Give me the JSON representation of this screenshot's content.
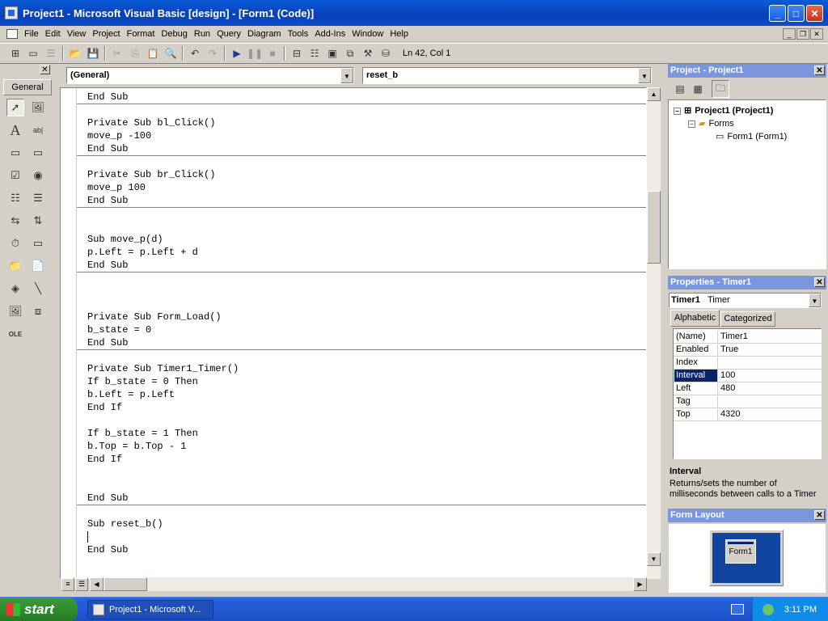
{
  "window": {
    "title": "Project1 - Microsoft Visual Basic [design] - [Form1 (Code)]",
    "minimize": "_",
    "maximize": "□",
    "close": "✕"
  },
  "menu": {
    "items": [
      "File",
      "Edit",
      "View",
      "Project",
      "Format",
      "Debug",
      "Run",
      "Query",
      "Diagram",
      "Tools",
      "Add-Ins",
      "Window",
      "Help"
    ]
  },
  "toolbar": {
    "status": "Ln 42, Col 1",
    "icons": [
      "add-project-icon",
      "add-form-icon",
      "menu-editor-icon",
      "open-icon",
      "save-icon",
      "cut-icon",
      "copy-icon",
      "paste-icon",
      "find-icon",
      "undo-icon",
      "redo-icon",
      "start-icon",
      "break-icon",
      "end-icon",
      "project-explorer-icon",
      "properties-window-icon",
      "form-layout-icon",
      "object-browser-icon",
      "toolbox-icon",
      "data-view-icon"
    ]
  },
  "toolbox": {
    "close": "✕",
    "tab": "General"
  },
  "code": {
    "object_combo": "(General)",
    "proc_combo": "reset_b",
    "lines": [
      "End Sub",
      "Private Sub bl_Click()",
      "move_p -100",
      "End Sub",
      "Private Sub br_Click()",
      "move_p 100",
      "End Sub",
      "Sub move_p(d)",
      "p.Left = p.Left + d",
      "End Sub",
      "Private Sub Form_Load()",
      "b_state = 0",
      "End Sub",
      "Private Sub Timer1_Timer()",
      "If b_state = 0 Then",
      "b.Left = p.Left",
      "End If",
      "If b_state = 1 Then",
      "b.Top = b.Top - 1",
      "End If",
      "End Sub",
      "Sub reset_b()",
      "End Sub"
    ]
  },
  "project": {
    "title": "Project - Project1",
    "close": "✕",
    "root": "Project1 (Project1)",
    "folder": "Forms",
    "form": "Form1 (Form1)"
  },
  "properties": {
    "title": "Properties - Timer1",
    "close": "✕",
    "object": "Timer1",
    "object_type": "Timer",
    "tabs": [
      "Alphabetic",
      "Categorized"
    ],
    "rows": [
      {
        "k": "(Name)",
        "v": "Timer1"
      },
      {
        "k": "Enabled",
        "v": "True"
      },
      {
        "k": "Index",
        "v": ""
      },
      {
        "k": "Interval",
        "v": "100"
      },
      {
        "k": "Left",
        "v": "480"
      },
      {
        "k": "Tag",
        "v": ""
      },
      {
        "k": "Top",
        "v": "4320"
      }
    ],
    "desc_title": "Interval",
    "desc_text": "Returns/sets the number of milliseconds between calls to a Timer"
  },
  "layout": {
    "title": "Form Layout",
    "close": "✕",
    "form": "Form1"
  },
  "taskbar": {
    "start": "start",
    "item": "Project1 - Microsoft V...",
    "clock": "3:11 PM"
  },
  "colors": {
    "title": "#0a5bd8",
    "panel_active": "#0a246a",
    "panel_inactive": "#7a96df",
    "selection": "#0a246a",
    "start": "#2f8d2f"
  }
}
